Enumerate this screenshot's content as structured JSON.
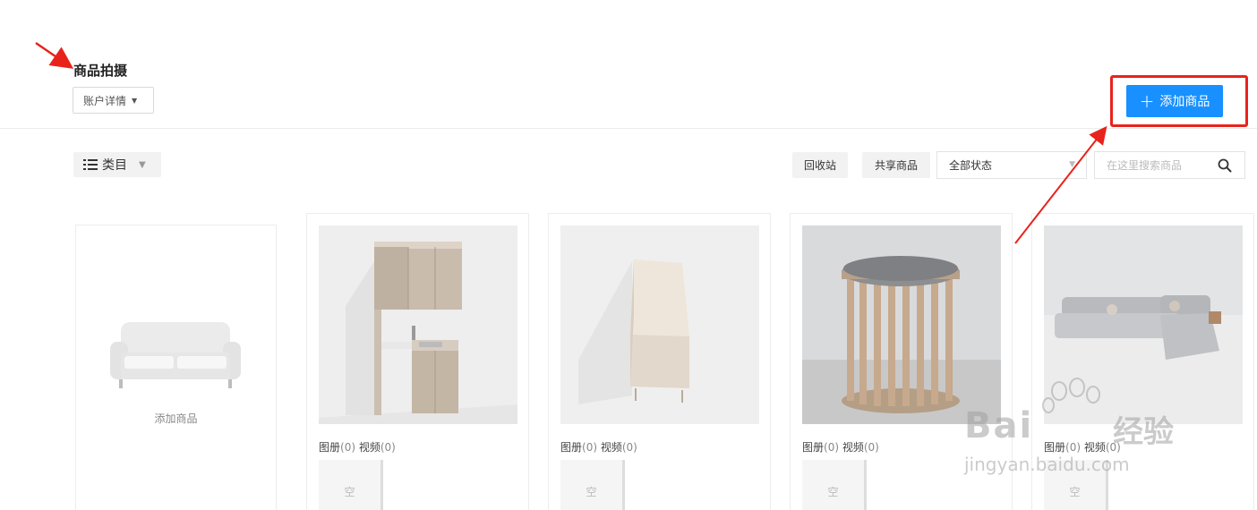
{
  "header": {
    "title": "商品拍摄",
    "account_select": "账户详情",
    "add_button": "添加商品"
  },
  "toolbar": {
    "category_label": "类目",
    "recycle_label": "回收站",
    "shared_label": "共享商品",
    "status_value": "全部状态",
    "search_placeholder": "在这里搜索商品"
  },
  "add_card": {
    "label": "添加商品"
  },
  "products": [
    {
      "album_label": "图册",
      "album_count": "(0)",
      "video_label": "视频",
      "video_count": "(0)",
      "empty_label": "空",
      "image": "kitchen-cabinet"
    },
    {
      "album_label": "图册",
      "album_count": "(0)",
      "video_label": "视频",
      "video_count": "(0)",
      "empty_label": "空",
      "image": "sideboard"
    },
    {
      "album_label": "图册",
      "album_count": "(0)",
      "video_label": "视频",
      "video_count": "(0)",
      "empty_label": "空",
      "image": "round-slatted-table"
    },
    {
      "album_label": "图册",
      "album_count": "(0)",
      "video_label": "视频",
      "video_count": "(0)",
      "empty_label": "空",
      "image": "sectional-sofa"
    }
  ],
  "watermark": {
    "brand": "Bai",
    "brand_tail": "经验",
    "url": "jingyan.baidu.com"
  },
  "colors": {
    "accent": "#1890ff",
    "annotation_red": "#e8231b"
  }
}
